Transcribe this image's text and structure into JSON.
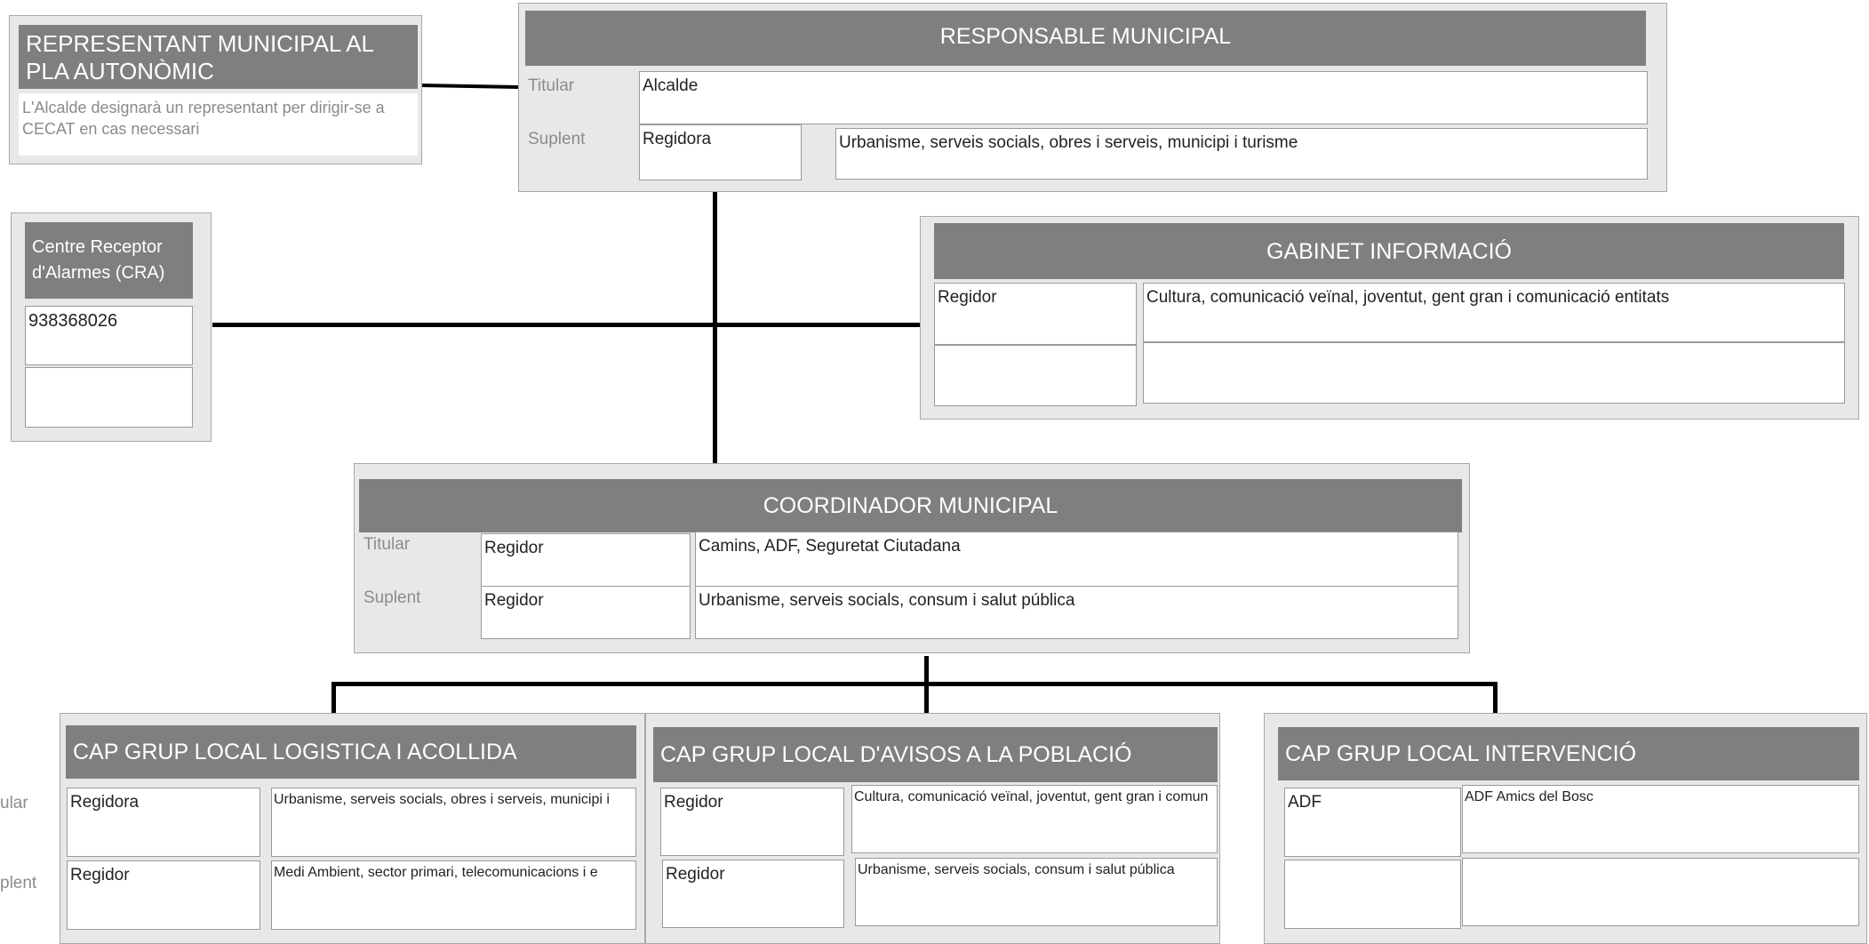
{
  "representant": {
    "title": "REPRESENTANT MUNICIPAL AL PLA AUTONÒMIC",
    "note": "L'Alcalde designarà un representant per dirigir-se a CECAT en cas necessari"
  },
  "responsable": {
    "title": "RESPONSABLE MUNICIPAL",
    "titular_label": "Titular",
    "suplent_label": "Suplent",
    "titular_role": "Alcalde",
    "suplent_role": "Regidora",
    "suplent_area": "Urbanisme, serveis socials, obres i serveis, municipi i turisme"
  },
  "cra": {
    "title": "Centre Receptor d'Alarmes (CRA)",
    "phone": "938368026",
    "phone2": ""
  },
  "gabinet": {
    "title": "GABINET INFORMACIÓ",
    "role": "Regidor",
    "area": "Cultura, comunicació veïnal, joventut, gent gran i comunicació entitats",
    "role2": "",
    "area2": ""
  },
  "coordinador": {
    "title": "COORDINADOR MUNICIPAL",
    "titular_label": "Titular",
    "suplent_label": "Suplent",
    "titular_role": "Regidor",
    "titular_area": "Camins, ADF, Seguretat Ciutadana",
    "suplent_role": "Regidor",
    "suplent_area": "Urbanisme, serveis socials, consum i salut pública"
  },
  "side_labels": {
    "titular": "ular",
    "suplent": "plent"
  },
  "logistica": {
    "title": "CAP GRUP LOCAL LOGISTICA I ACOLLIDA",
    "titular_role": "Regidora",
    "titular_area": "Urbanisme, serveis socials, obres i serveis, municipi i",
    "suplent_role": "Regidor",
    "suplent_area": "Medi Ambient, sector primari, telecomunicacions i e"
  },
  "avisos": {
    "title": "CAP GRUP LOCAL D'AVISOS A LA POBLACIÓ",
    "titular_role": "Regidor",
    "titular_area": "Cultura, comunicació veïnal, joventut, gent gran i comun",
    "suplent_role": "Regidor",
    "suplent_area": "Urbanisme, serveis socials, consum i salut pública"
  },
  "intervencio": {
    "title": "CAP GRUP LOCAL INTERVENCIÓ",
    "titular_role": "ADF",
    "titular_area": "ADF Amics del Bosc",
    "suplent_role": "",
    "suplent_area": ""
  }
}
